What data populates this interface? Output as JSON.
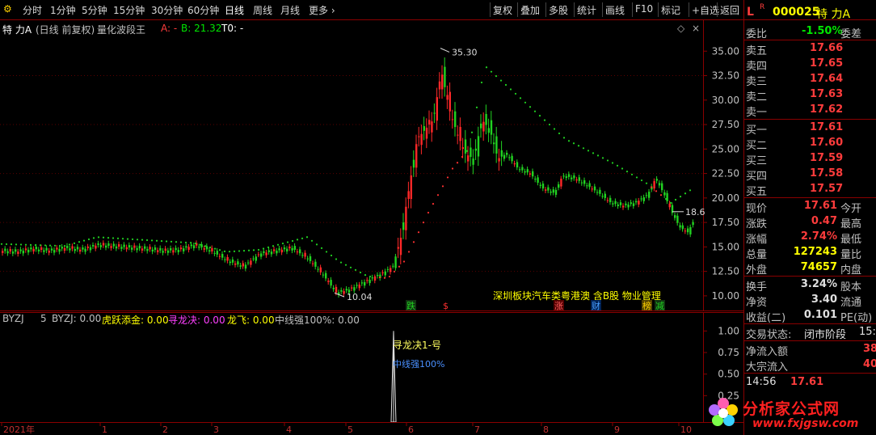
{
  "toolbar": {
    "left_items": [
      "分时",
      "1分钟",
      "5分钟",
      "15分钟",
      "30分钟",
      "60分钟",
      "日线",
      "周线",
      "月线",
      "更多"
    ],
    "right_items": [
      "复权",
      "叠加",
      "多股",
      "统计",
      "画线",
      "F10",
      "标记",
      "+自选",
      "返回"
    ],
    "active": "日线"
  },
  "main_header": {
    "stock_name": "特 力A",
    "mode": "(日线 前复权)",
    "indicator": "量化波段王",
    "a_label": "A: -",
    "b_label": "B: 21.32",
    "t0_label": "T0: -"
  },
  "chart_data": [
    {
      "type": "candlestick",
      "ylim": [
        9,
        37.5
      ],
      "y_ticks": [
        10.0,
        12.5,
        15.0,
        17.5,
        20.0,
        22.5,
        25.0,
        27.5,
        30.0,
        32.5,
        35.0
      ],
      "high_label": "35.30",
      "low_label": "10.04",
      "last_label": "18.6",
      "x_ticks": [
        "2021年",
        "1",
        "2",
        "3",
        "4",
        "5",
        "6",
        "7",
        "8",
        "9",
        "10"
      ],
      "close_path": [
        [
          0,
          14.6
        ],
        [
          20,
          14.5
        ],
        [
          40,
          14.8
        ],
        [
          60,
          14.6
        ],
        [
          80,
          14.9
        ],
        [
          100,
          14.7
        ],
        [
          120,
          15.2
        ],
        [
          150,
          15.0
        ],
        [
          180,
          14.8
        ],
        [
          200,
          14.6
        ],
        [
          220,
          14.7
        ],
        [
          240,
          15.2
        ],
        [
          260,
          14.6
        ],
        [
          280,
          13.6
        ],
        [
          300,
          13.0
        ],
        [
          320,
          14.3
        ],
        [
          340,
          14.6
        ],
        [
          360,
          14.9
        ],
        [
          380,
          13.8
        ],
        [
          400,
          12.0
        ],
        [
          415,
          10.3
        ],
        [
          430,
          10.6
        ],
        [
          450,
          11.4
        ],
        [
          470,
          12.2
        ],
        [
          485,
          13.0
        ],
        [
          495,
          16.0
        ],
        [
          505,
          21.0
        ],
        [
          515,
          26.0
        ],
        [
          525,
          27.0
        ],
        [
          535,
          28.0
        ],
        [
          545,
          33.0
        ],
        [
          555,
          29.0
        ],
        [
          565,
          26.5
        ],
        [
          575,
          24.5
        ],
        [
          585,
          24.0
        ],
        [
          595,
          28.0
        ],
        [
          605,
          27.0
        ],
        [
          615,
          24.0
        ],
        [
          625,
          24.5
        ],
        [
          640,
          23.0
        ],
        [
          655,
          22.5
        ],
        [
          670,
          21.0
        ],
        [
          685,
          20.5
        ],
        [
          695,
          22.3
        ],
        [
          710,
          22.0
        ],
        [
          725,
          21.3
        ],
        [
          740,
          20.5
        ],
        [
          755,
          19.5
        ],
        [
          770,
          19.2
        ],
        [
          785,
          19.5
        ],
        [
          800,
          20.3
        ],
        [
          810,
          22.0
        ],
        [
          820,
          20.5
        ],
        [
          830,
          18.6
        ],
        [
          840,
          17.0
        ],
        [
          850,
          16.5
        ],
        [
          858,
          17.8
        ]
      ],
      "trail_path": [
        [
          0,
          15.3
        ],
        [
          80,
          15.1
        ],
        [
          120,
          16.0
        ],
        [
          180,
          15.7
        ],
        [
          240,
          15.4
        ],
        [
          280,
          14.5
        ],
        [
          320,
          14.7
        ],
        [
          380,
          16.0
        ],
        [
          420,
          13.5
        ],
        [
          455,
          12.0
        ],
        [
          480,
          11.8
        ],
        [
          500,
          13.5
        ],
        [
          530,
          18.5
        ],
        [
          560,
          23.0
        ],
        [
          580,
          25.0
        ],
        [
          600,
          33.5
        ],
        [
          640,
          30.5
        ],
        [
          700,
          26.0
        ],
        [
          760,
          23.5
        ],
        [
          800,
          21.5
        ],
        [
          830,
          19.5
        ],
        [
          858,
          21.0
        ]
      ],
      "annotations": [
        "跌",
        "$",
        "涨",
        "财",
        "榜",
        "减"
      ],
      "tags": "深圳板块汽车类粤港澳 含B股 物业管理"
    },
    {
      "type": "bar",
      "ylim": [
        0,
        1.05
      ],
      "y_ticks": [
        0.25,
        0.5,
        0.75,
        1.0
      ],
      "series": [
        {
          "name": "中线强100%",
          "values": [
            1.0
          ]
        }
      ]
    }
  ],
  "indicator_header": {
    "name": "BYZJ",
    "param": "5",
    "byzj": "BYZJ: 0.00",
    "huyue": "虎跃添金: 0.00",
    "xunlong": "寻龙决: 0.00",
    "longfei": "龙飞: 0.00",
    "zhongxian": "中线强100%: 0.00"
  },
  "indicator_labels": {
    "label1": "寻龙决1-号",
    "label2": "中线强100%"
  },
  "quote": {
    "market_tag": "L",
    "r_tag": "R",
    "code": "000025",
    "name": "特 力A",
    "weibi_label": "委比",
    "weibi_value": "-1.50%",
    "weicha_label": "委差",
    "asks": [
      {
        "label": "卖五",
        "price": "17.66"
      },
      {
        "label": "卖四",
        "price": "17.65"
      },
      {
        "label": "卖三",
        "price": "17.64"
      },
      {
        "label": "卖二",
        "price": "17.63"
      },
      {
        "label": "卖一",
        "price": "17.62"
      }
    ],
    "bids": [
      {
        "label": "买一",
        "price": "17.61"
      },
      {
        "label": "买二",
        "price": "17.60"
      },
      {
        "label": "买三",
        "price": "17.59"
      },
      {
        "label": "买四",
        "price": "17.58"
      },
      {
        "label": "买五",
        "price": "17.57"
      }
    ],
    "stats": [
      {
        "label": "现价",
        "value": "17.61",
        "color": "#ff3c3c",
        "label2": "今开"
      },
      {
        "label": "涨跌",
        "value": "0.47",
        "color": "#ff3c3c",
        "label2": "最高"
      },
      {
        "label": "涨幅",
        "value": "2.74%",
        "color": "#ff3c3c",
        "label2": "最低"
      },
      {
        "label": "总量",
        "value": "127243",
        "color": "#ffff00",
        "label2": "量比"
      },
      {
        "label": "外盘",
        "value": "74657",
        "color": "#ffff00",
        "label2": "内盘"
      }
    ],
    "stats2": [
      {
        "label": "换手",
        "value": "3.24%",
        "color": "#e0e0e0",
        "label2": "股本"
      },
      {
        "label": "净资",
        "value": "3.40",
        "color": "#e0e0e0",
        "label2": "流通"
      },
      {
        "label": "收益(二)",
        "value": "0.101",
        "color": "#e0e0e0",
        "label2": "PE(动)"
      }
    ],
    "status_label": "交易状态:",
    "status_value": "闭市阶段",
    "status_trail": "15:",
    "netflow_label": "净流入额",
    "netflow_value": "38",
    "block_label": "大宗流入",
    "block_value": "40",
    "time": "14:56",
    "time_price": "17.61"
  },
  "watermark": {
    "text": "分析家公式网",
    "url": "www.fxjgsw.com"
  }
}
